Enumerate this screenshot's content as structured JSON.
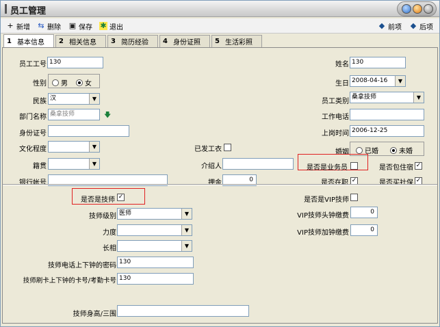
{
  "window": {
    "title": "员工管理"
  },
  "toolbar": {
    "add": "新增",
    "delete": "删除",
    "save": "保存",
    "exit": "退出",
    "prev": "前项",
    "next": "后项"
  },
  "tabs": [
    {
      "num": "1",
      "label": "基本信息"
    },
    {
      "num": "2",
      "label": "相关信息"
    },
    {
      "num": "3",
      "label": "简历经验"
    },
    {
      "num": "4",
      "label": "身份证照"
    },
    {
      "num": "5",
      "label": "生活彩照"
    }
  ],
  "form": {
    "employee_no": {
      "label": "员工工号",
      "value": "130"
    },
    "name": {
      "label": "姓名",
      "value": "130"
    },
    "gender": {
      "label": "性别",
      "male": "男",
      "female": "女"
    },
    "birthday": {
      "label": "生日",
      "value": "2008-04-16"
    },
    "ethnicity": {
      "label": "民族",
      "value": "汉"
    },
    "employee_type": {
      "label": "员工类别",
      "value": "桑拿技师"
    },
    "department": {
      "label": "部门名称",
      "value": "桑拿技师"
    },
    "work_phone": {
      "label": "工作电话",
      "value": ""
    },
    "id_no": {
      "label": "身份证号",
      "value": ""
    },
    "hire_date": {
      "label": "上岗时间",
      "value": "2006-12-25"
    },
    "education": {
      "label": "文化程度",
      "value": ""
    },
    "uniform_issued": {
      "label": "已发工衣"
    },
    "marriage": {
      "label": "婚姻",
      "married": "已婚",
      "single": "未婚"
    },
    "native_place": {
      "label": "籍贯",
      "value": ""
    },
    "referrer": {
      "label": "介绍人",
      "value": ""
    },
    "is_salesperson": {
      "label": "是否是业务员"
    },
    "meal_lodging": {
      "label": "是否包住宿"
    },
    "bank_account": {
      "label": "银行帐号",
      "value": ""
    },
    "deposit": {
      "label": "押金",
      "value": "0"
    },
    "on_job": {
      "label": "是否在职"
    },
    "social_insurance": {
      "label": "是否买社保"
    },
    "is_technician": {
      "label": "是否是技师"
    },
    "is_vip_technician": {
      "label": "是否是VIP技师"
    },
    "tech_level": {
      "label": "技师级别",
      "value": "医师"
    },
    "vip_head_fee": {
      "label": "VIP技师头钟缴费",
      "value": "0"
    },
    "strength": {
      "label": "力度",
      "value": ""
    },
    "vip_add_fee": {
      "label": "VIP技师加钟缴费",
      "value": "0"
    },
    "looks": {
      "label": "长相",
      "value": ""
    },
    "tech_phone_pwd": {
      "label": "技师电话上下钟的密码",
      "value": "130"
    },
    "tech_card_no": {
      "label": "技师刷卡上下钟的卡号/考勤卡号",
      "value": "130"
    },
    "tech_body": {
      "label": "技师身高/三围",
      "value": ""
    }
  }
}
